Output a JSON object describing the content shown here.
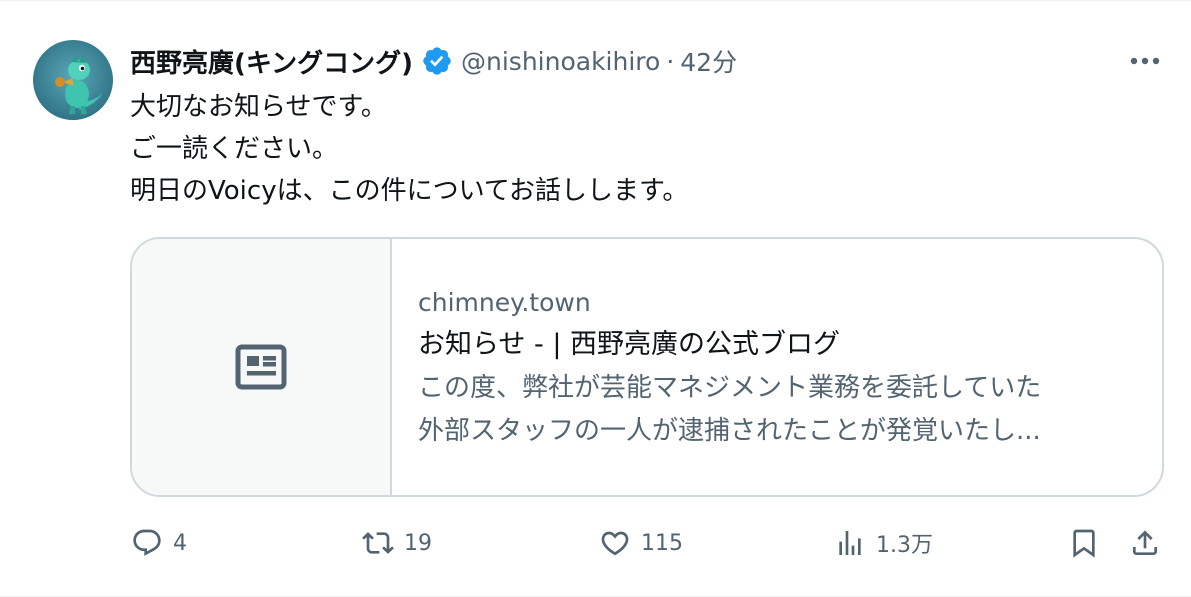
{
  "author": {
    "display_name": "西野亮廣(キングコング)",
    "handle": "@nishinoakihiro",
    "separator": "·",
    "time": "42分",
    "verified_icon": "verified-badge-icon",
    "avatar_icon": "green-dinosaur-trumpet-avatar"
  },
  "tweet": {
    "lines": [
      "大切なお知らせです。",
      "ご一読ください。",
      "明日のVoicyは、この件についてお話しします。"
    ]
  },
  "card": {
    "thumbnail_icon": "article-icon",
    "domain": "chimney.town",
    "title": "お知らせ - | 西野亮廣の公式ブログ",
    "description_lines": [
      "この度、弊社が芸能マネジメント業務を委託していた",
      "外部スタッフの一人が逮捕されたことが発覚いたし..."
    ]
  },
  "actions": {
    "reply_count": "4",
    "retweet_count": "19",
    "like_count": "115",
    "views_count": "1.3万"
  },
  "colors": {
    "primary_text": "#0f1419",
    "secondary_text": "#536471",
    "verified_blue": "#1d9bf0",
    "card_border": "#cfd9de",
    "card_thumb_bg": "#f7f9f9"
  }
}
